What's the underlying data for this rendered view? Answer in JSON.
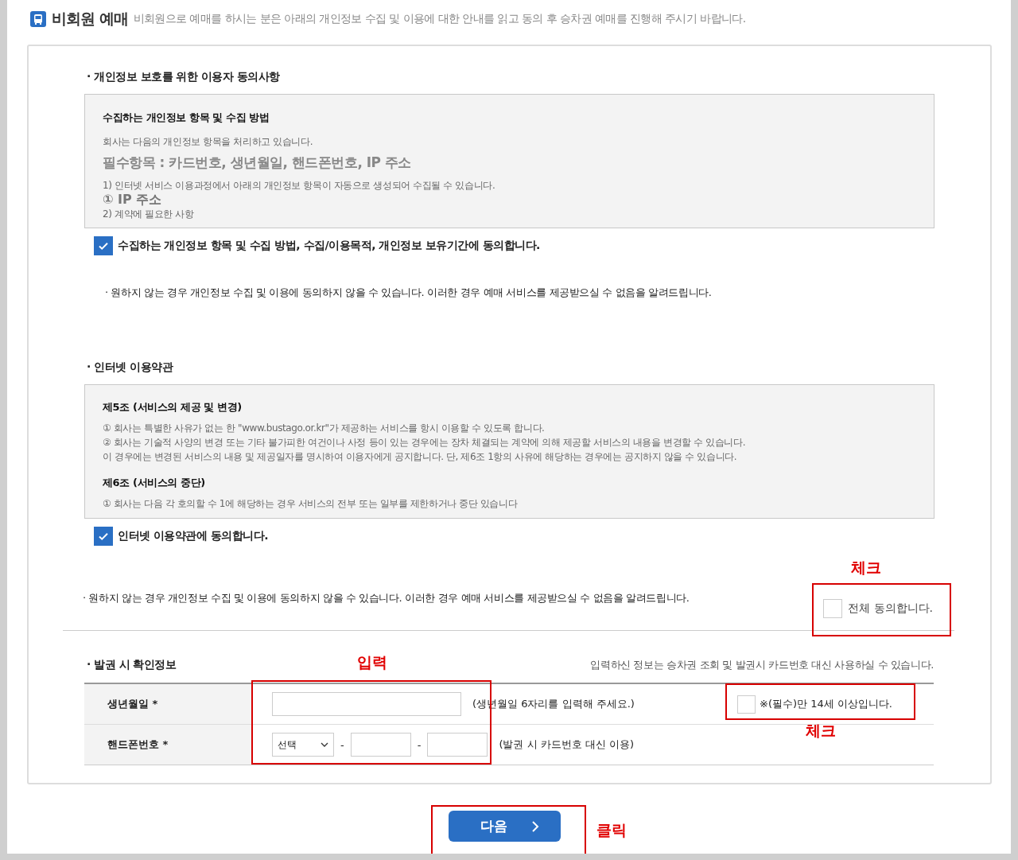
{
  "header": {
    "title": "비회원 예매",
    "description": "비회원으로 예매를 하시는 분은 아래의 개인정보 수집 및 이용에 대한 안내를 읽고 동의 후 승차권 예매를  진행해 주시기 바랍니다."
  },
  "privacy": {
    "heading": "· 개인정보 보호를 위한 이용자 동의사항",
    "box": [
      {
        "kind": "title",
        "text": "수집하는 개인정보 항목 및 수집 방법"
      },
      {
        "kind": "text",
        "text": "회사는 다음의 개인정보 항목을 처리하고 있습니다."
      },
      {
        "kind": "large",
        "text": "필수항목 : 카드번호, 생년월일, 핸드폰번호, IP 주소"
      },
      {
        "kind": "text",
        "text": "1) 인터넷 서비스 이용과정에서 아래의 개인정보 항목이 자동으로 생성되어 수집될 수 있습니다."
      },
      {
        "kind": "medium",
        "text": "① IP 주소"
      },
      {
        "kind": "text",
        "text": "2) 계약에 필요한 사항"
      }
    ],
    "agree": {
      "label": "수집하는 개인정보 항목 및 수집 방법, 수집/이용목적, 개인정보 보유기간에 동의합니다.",
      "checked": true
    },
    "notice": "· 원하지 않는 경우 개인정보 수집 및 이용에 동의하지 않을 수 있습니다. 이러한 경우 예매 서비스를 제공받으실 수 없음을 알려드립니다."
  },
  "terms": {
    "heading": "· 인터넷 이용약관",
    "box": [
      {
        "kind": "title",
        "text": "제5조 (서비스의 제공 및 변경)"
      },
      {
        "kind": "text",
        "text": "① 회사는 특별한 사유가 없는 한 \"www.bustago.or.kr\"가 제공하는 서비스를 항시 이용할 수 있도록 합니다."
      },
      {
        "kind": "text",
        "text": "② 회사는 기술적 사양의 변경 또는 기타 불가피한 여건이나 사정 등이 있는 경우에는 장차 체결되는 계약에 의해 제공할 서비스의 내용을 변경할 수 있습니다."
      },
      {
        "kind": "text",
        "text": "이 경우에는 변경된 서비스의 내용 및 제공일자를 명시하여 이용자에게 공지합니다. 단, 제6조 1항의 사유에 해당하는 경우에는 공지하지 않을 수 있습니다."
      },
      {
        "kind": "title",
        "text": "제6조 (서비스의 중단)"
      },
      {
        "kind": "text",
        "text": "① 회사는 다음 각 호의할 수 1에 해당하는 경우 서비스의 전부 또는 일부를 제한하거나 중단 있습니다"
      }
    ],
    "agree": {
      "label": "인터넷 이용약관에 동의합니다.",
      "checked": true
    },
    "notice": "· 원하지 않는 경우 개인정보 수집 및 이용에 동의하지 않을 수 있습니다. 이러한 경우 예매 서비스를 제공받으실 수 없음을 알려드립니다."
  },
  "all_agree": {
    "label": "전체 동의합니다.",
    "checked": false
  },
  "ticket_info": {
    "heading": "· 발권 시 확인정보",
    "hint": "입력하신 정보는 승차권 조회 및 발권시 카드번호 대신 사용하실 수 있습니다.",
    "birth": {
      "label": "생년월일 *",
      "note": "(생년월일 6자리를 입력해 주세요.)",
      "age_check": {
        "label": "※(필수)만 14세 이상입니다.",
        "checked": false
      }
    },
    "phone": {
      "label": "핸드폰번호 *",
      "select": "선택",
      "separators": [
        "-",
        "-"
      ],
      "note": "(발권 시 카드번호 대신 이용)"
    }
  },
  "next_button": {
    "label": "다음"
  },
  "annotations": [
    {
      "text": "체크"
    },
    {
      "text": "입력"
    },
    {
      "text": "체크"
    },
    {
      "text": "클릭"
    }
  ]
}
